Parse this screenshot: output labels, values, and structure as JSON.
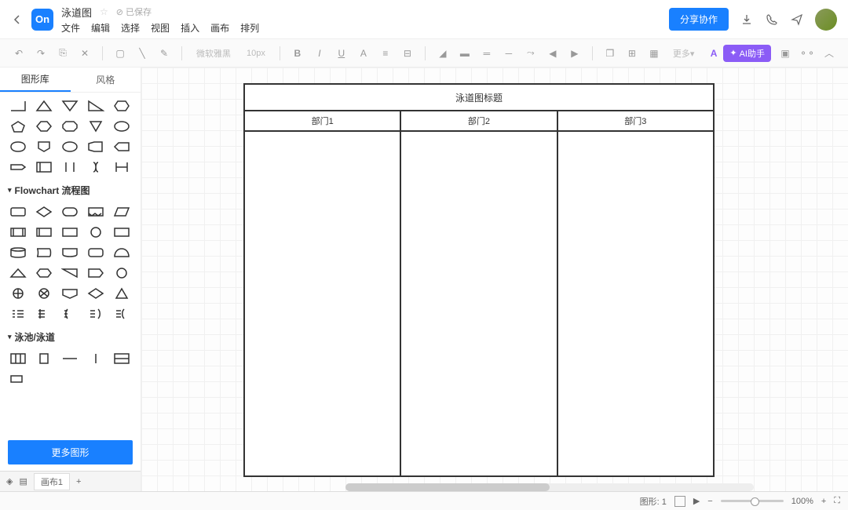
{
  "header": {
    "doc_title": "泳道图",
    "saved_label": "已保存",
    "menus": [
      "文件",
      "编辑",
      "选择",
      "视图",
      "插入",
      "画布",
      "排列"
    ],
    "share_label": "分享协作"
  },
  "toolbar": {
    "font_label": "微软雅黑",
    "font_size": "10px",
    "more_label": "更多",
    "ai_label": "AI助手"
  },
  "sidebar": {
    "tab_shapes": "图形库",
    "tab_styles": "风格",
    "cat_flowchart": "Flowchart 流程图",
    "cat_swimlane": "泳池/泳道",
    "more_shapes": "更多图形"
  },
  "canvas": {
    "title": "泳道图标题",
    "lanes": [
      "部门1",
      "部门2",
      "部门3"
    ]
  },
  "bottom": {
    "page_label": "画布1"
  },
  "status": {
    "shape_label": "图形",
    "shape_count": "1",
    "zoom": "100%"
  }
}
